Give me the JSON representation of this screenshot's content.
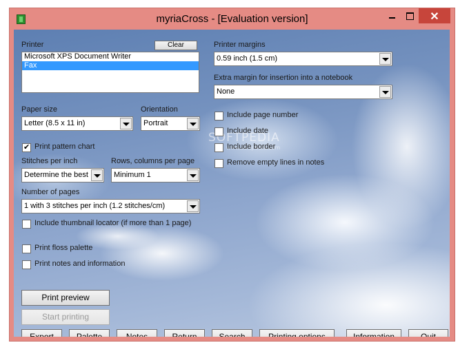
{
  "window": {
    "title": "myriaCross - [Evaluation version]",
    "close_glyph": "✕"
  },
  "watermark": {
    "text": "SOFTPEDIA",
    "url": "www.softpedia.com"
  },
  "printer": {
    "label": "Printer",
    "clear_label": "Clear",
    "items": [
      "Microsoft XPS Document Writer",
      "Fax"
    ],
    "selected": "Fax"
  },
  "paper_size": {
    "label": "Paper size",
    "value": "Letter (8.5 x 11 in)"
  },
  "orientation": {
    "label": "Orientation",
    "value": "Portrait"
  },
  "print_pattern_chart": {
    "label": "Print pattern chart",
    "checked": true
  },
  "stitches_per_inch": {
    "label": "Stitches per inch",
    "value": "Determine the best"
  },
  "rows_columns": {
    "label": "Rows, columns per page",
    "value": "Minimum 1"
  },
  "number_of_pages": {
    "label": "Number of pages",
    "value": "1 with 3 stitches per inch (1.2 stitches/cm)"
  },
  "include_thumbnail": {
    "label": "Include thumbnail locator (if more than 1 page)",
    "checked": false
  },
  "print_floss": {
    "label": "Print floss palette",
    "checked": false
  },
  "print_notes": {
    "label": "Print notes and information",
    "checked": false
  },
  "printer_margins": {
    "label": "Printer margins",
    "value": "0.59 inch  (1.5 cm)"
  },
  "extra_margin": {
    "label": "Extra margin for insertion into a notebook",
    "value": "None"
  },
  "options": [
    {
      "label": "Include page number",
      "checked": false
    },
    {
      "label": "Include date",
      "checked": false
    },
    {
      "label": "Include border",
      "checked": false
    },
    {
      "label": "Remove empty lines in notes",
      "checked": false
    }
  ],
  "actions": {
    "print_preview": "Print preview",
    "start_printing": "Start printing"
  },
  "toolbar": {
    "export": "Export",
    "palette": "Palette",
    "notes": "Notes",
    "return": "Return",
    "search": "Search",
    "printing_options": "Printing options",
    "information": "Information",
    "quit": "Quit"
  }
}
